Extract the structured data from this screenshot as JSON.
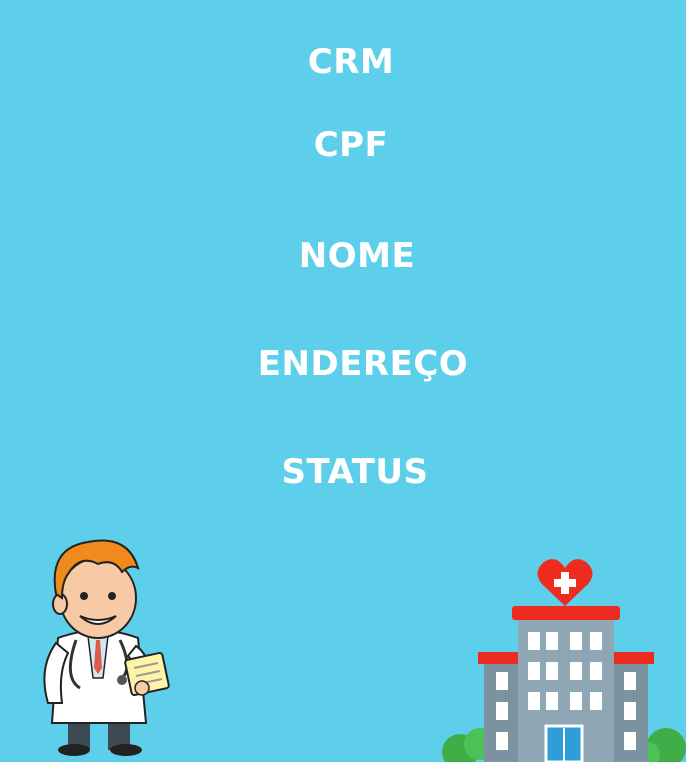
{
  "form": {
    "fields": [
      {
        "label": "CRM"
      },
      {
        "label": "CPF"
      },
      {
        "label": "NOME"
      },
      {
        "label": "ENDEREÇO"
      },
      {
        "label": "STATUS"
      }
    ]
  },
  "illustrations": {
    "doctor_icon": "doctor-illustration-icon",
    "hospital_icon": "hospital-illustration-icon"
  },
  "colors": {
    "background": "#5ecfea",
    "label_text": "#ffffff"
  }
}
